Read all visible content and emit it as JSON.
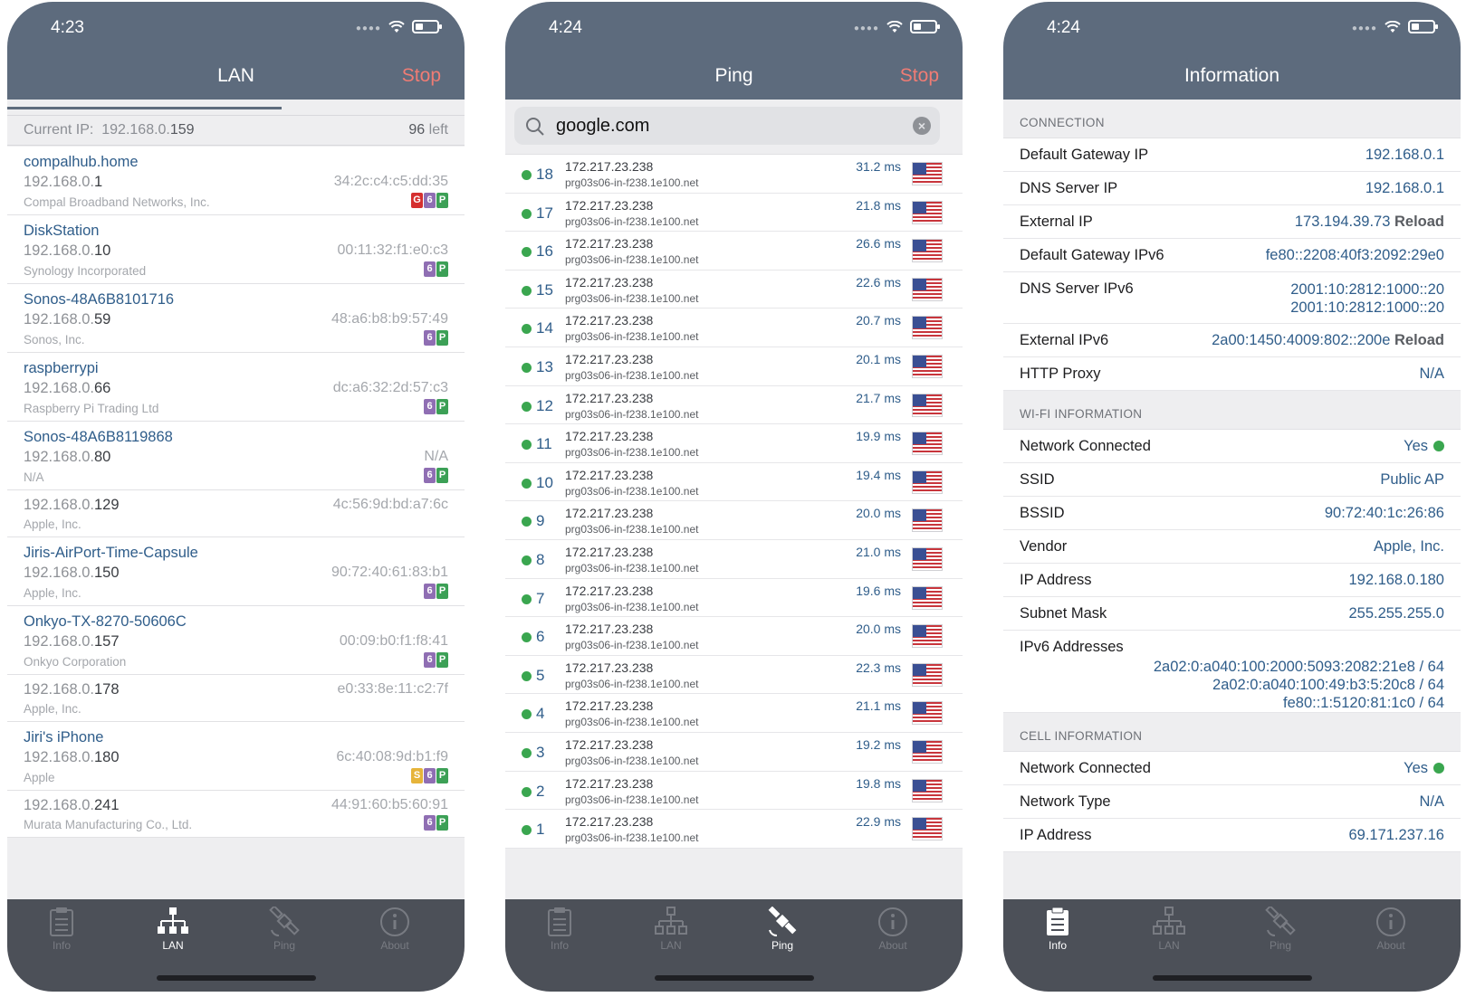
{
  "status": {
    "lan_time": "4:23",
    "ping_time": "4:24",
    "info_time": "4:24"
  },
  "tabs": [
    {
      "label": "Info",
      "icon": "clipboard-icon"
    },
    {
      "label": "LAN",
      "icon": "network-icon"
    },
    {
      "label": "Ping",
      "icon": "satellite-icon"
    },
    {
      "label": "About",
      "icon": "info-circle-icon"
    }
  ],
  "lan": {
    "title": "LAN",
    "action": "Stop",
    "progress": 0.6,
    "current_ip_label": "Current IP:",
    "current_ip_prefix": "192.168.0.",
    "current_ip_suffix": "159",
    "left_count": "96",
    "left_label": "left",
    "devices": [
      {
        "name": "compalhub.home",
        "ip_prefix": "192.168.0.",
        "ip_suffix": "1",
        "mac": "34:2c:c4:c5:dd:35",
        "vendor": "Compal Broadband Networks, Inc.",
        "badges": [
          "G",
          "6",
          "P"
        ]
      },
      {
        "name": "DiskStation",
        "ip_prefix": "192.168.0.",
        "ip_suffix": "10",
        "mac": "00:11:32:f1:e0:c3",
        "vendor": "Synology Incorporated",
        "badges": [
          "6",
          "P"
        ]
      },
      {
        "name": "Sonos-48A6B8101716",
        "ip_prefix": "192.168.0.",
        "ip_suffix": "59",
        "mac": "48:a6:b8:b9:57:49",
        "vendor": "Sonos, Inc.",
        "badges": [
          "6",
          "P"
        ]
      },
      {
        "name": "raspberrypi",
        "ip_prefix": "192.168.0.",
        "ip_suffix": "66",
        "mac": "dc:a6:32:2d:57:c3",
        "vendor": "Raspberry Pi Trading Ltd",
        "badges": [
          "6",
          "P"
        ]
      },
      {
        "name": "Sonos-48A6B8119868",
        "ip_prefix": "192.168.0.",
        "ip_suffix": "80",
        "mac": "N/A",
        "vendor": "N/A",
        "badges": [
          "6",
          "P"
        ]
      },
      {
        "name": "",
        "ip_prefix": "192.168.0.",
        "ip_suffix": "129",
        "mac": "4c:56:9d:bd:a7:6c",
        "vendor": "Apple, Inc.",
        "badges": []
      },
      {
        "name": "Jiris-AirPort-Time-Capsule",
        "ip_prefix": "192.168.0.",
        "ip_suffix": "150",
        "mac": "90:72:40:61:83:b1",
        "vendor": "Apple, Inc.",
        "badges": [
          "6",
          "P"
        ]
      },
      {
        "name": "Onkyo-TX-8270-50606C",
        "ip_prefix": "192.168.0.",
        "ip_suffix": "157",
        "mac": "00:09:b0:f1:f8:41",
        "vendor": "Onkyo Corporation",
        "badges": [
          "6",
          "P"
        ]
      },
      {
        "name": "",
        "ip_prefix": "192.168.0.",
        "ip_suffix": "178",
        "mac": "e0:33:8e:11:c2:7f",
        "vendor": "Apple, Inc.",
        "badges": []
      },
      {
        "name": "Jiri's iPhone",
        "ip_prefix": "192.168.0.",
        "ip_suffix": "180",
        "mac": "6c:40:08:9d:b1:f9",
        "vendor": "Apple",
        "badges": [
          "S",
          "6",
          "P"
        ]
      },
      {
        "name": "",
        "ip_prefix": "192.168.0.",
        "ip_suffix": "241",
        "mac": "44:91:60:b5:60:91",
        "vendor": "Murata Manufacturing Co., Ltd.",
        "badges": [
          "6",
          "P"
        ]
      }
    ]
  },
  "ping": {
    "title": "Ping",
    "action": "Stop",
    "query": "google.com",
    "rows": [
      {
        "seq": "18",
        "ip": "172.217.23.238",
        "host": "prg03s06-in-f238.1e100.net",
        "ms": "31.2 ms"
      },
      {
        "seq": "17",
        "ip": "172.217.23.238",
        "host": "prg03s06-in-f238.1e100.net",
        "ms": "21.8 ms"
      },
      {
        "seq": "16",
        "ip": "172.217.23.238",
        "host": "prg03s06-in-f238.1e100.net",
        "ms": "26.6 ms"
      },
      {
        "seq": "15",
        "ip": "172.217.23.238",
        "host": "prg03s06-in-f238.1e100.net",
        "ms": "22.6 ms"
      },
      {
        "seq": "14",
        "ip": "172.217.23.238",
        "host": "prg03s06-in-f238.1e100.net",
        "ms": "20.7 ms"
      },
      {
        "seq": "13",
        "ip": "172.217.23.238",
        "host": "prg03s06-in-f238.1e100.net",
        "ms": "20.1 ms"
      },
      {
        "seq": "12",
        "ip": "172.217.23.238",
        "host": "prg03s06-in-f238.1e100.net",
        "ms": "21.7 ms"
      },
      {
        "seq": "11",
        "ip": "172.217.23.238",
        "host": "prg03s06-in-f238.1e100.net",
        "ms": "19.9 ms"
      },
      {
        "seq": "10",
        "ip": "172.217.23.238",
        "host": "prg03s06-in-f238.1e100.net",
        "ms": "19.4 ms"
      },
      {
        "seq": "9",
        "ip": "172.217.23.238",
        "host": "prg03s06-in-f238.1e100.net",
        "ms": "20.0 ms"
      },
      {
        "seq": "8",
        "ip": "172.217.23.238",
        "host": "prg03s06-in-f238.1e100.net",
        "ms": "21.0 ms"
      },
      {
        "seq": "7",
        "ip": "172.217.23.238",
        "host": "prg03s06-in-f238.1e100.net",
        "ms": "19.6 ms"
      },
      {
        "seq": "6",
        "ip": "172.217.23.238",
        "host": "prg03s06-in-f238.1e100.net",
        "ms": "20.0 ms"
      },
      {
        "seq": "5",
        "ip": "172.217.23.238",
        "host": "prg03s06-in-f238.1e100.net",
        "ms": "22.3 ms"
      },
      {
        "seq": "4",
        "ip": "172.217.23.238",
        "host": "prg03s06-in-f238.1e100.net",
        "ms": "21.1 ms"
      },
      {
        "seq": "3",
        "ip": "172.217.23.238",
        "host": "prg03s06-in-f238.1e100.net",
        "ms": "19.2 ms"
      },
      {
        "seq": "2",
        "ip": "172.217.23.238",
        "host": "prg03s06-in-f238.1e100.net",
        "ms": "19.8 ms"
      },
      {
        "seq": "1",
        "ip": "172.217.23.238",
        "host": "prg03s06-in-f238.1e100.net",
        "ms": "22.9 ms"
      }
    ]
  },
  "info": {
    "title": "Information",
    "connection": {
      "header": "CONNECTION",
      "gateway_label": "Default Gateway IP",
      "gateway": "192.168.0.1",
      "dns_label": "DNS Server IP",
      "dns": "192.168.0.1",
      "external_label": "External IP",
      "external": "173.194.39.73",
      "reload": "Reload",
      "gateway6_label": "Default Gateway IPv6",
      "gateway6": "fe80::2208:40f3:2092:29e0",
      "dns6_label": "DNS Server IPv6",
      "dns6_a": "2001:10:2812:1000::20",
      "dns6_b": "2001:10:2812:1000::20",
      "external6_label": "External IPv6",
      "external6": "2a00:1450:4009:802::200e",
      "proxy_label": "HTTP Proxy",
      "proxy": "N/A"
    },
    "wifi": {
      "header": "WI-FI INFORMATION",
      "connected_label": "Network Connected",
      "connected": "Yes",
      "ssid_label": "SSID",
      "ssid": "Public AP",
      "bssid_label": "BSSID",
      "bssid": "90:72:40:1c:26:86",
      "vendor_label": "Vendor",
      "vendor": "Apple, Inc.",
      "ip_label": "IP Address",
      "ip": "192.168.0.180",
      "mask_label": "Subnet Mask",
      "mask": "255.255.255.0",
      "ipv6_label": "IPv6 Addresses",
      "ipv6_a": "2a02:0:a040:100:2000:5093:2082:21e8 / 64",
      "ipv6_b": "2a02:0:a040:100:49:b3:5:20c8 / 64",
      "ipv6_c": "fe80::1:5120:81:1c0 / 64"
    },
    "cell": {
      "header": "CELL INFORMATION",
      "connected_label": "Network Connected",
      "connected": "Yes",
      "type_label": "Network Type",
      "type": "N/A",
      "ip_label": "IP Address",
      "ip": "69.171.237.16"
    }
  }
}
